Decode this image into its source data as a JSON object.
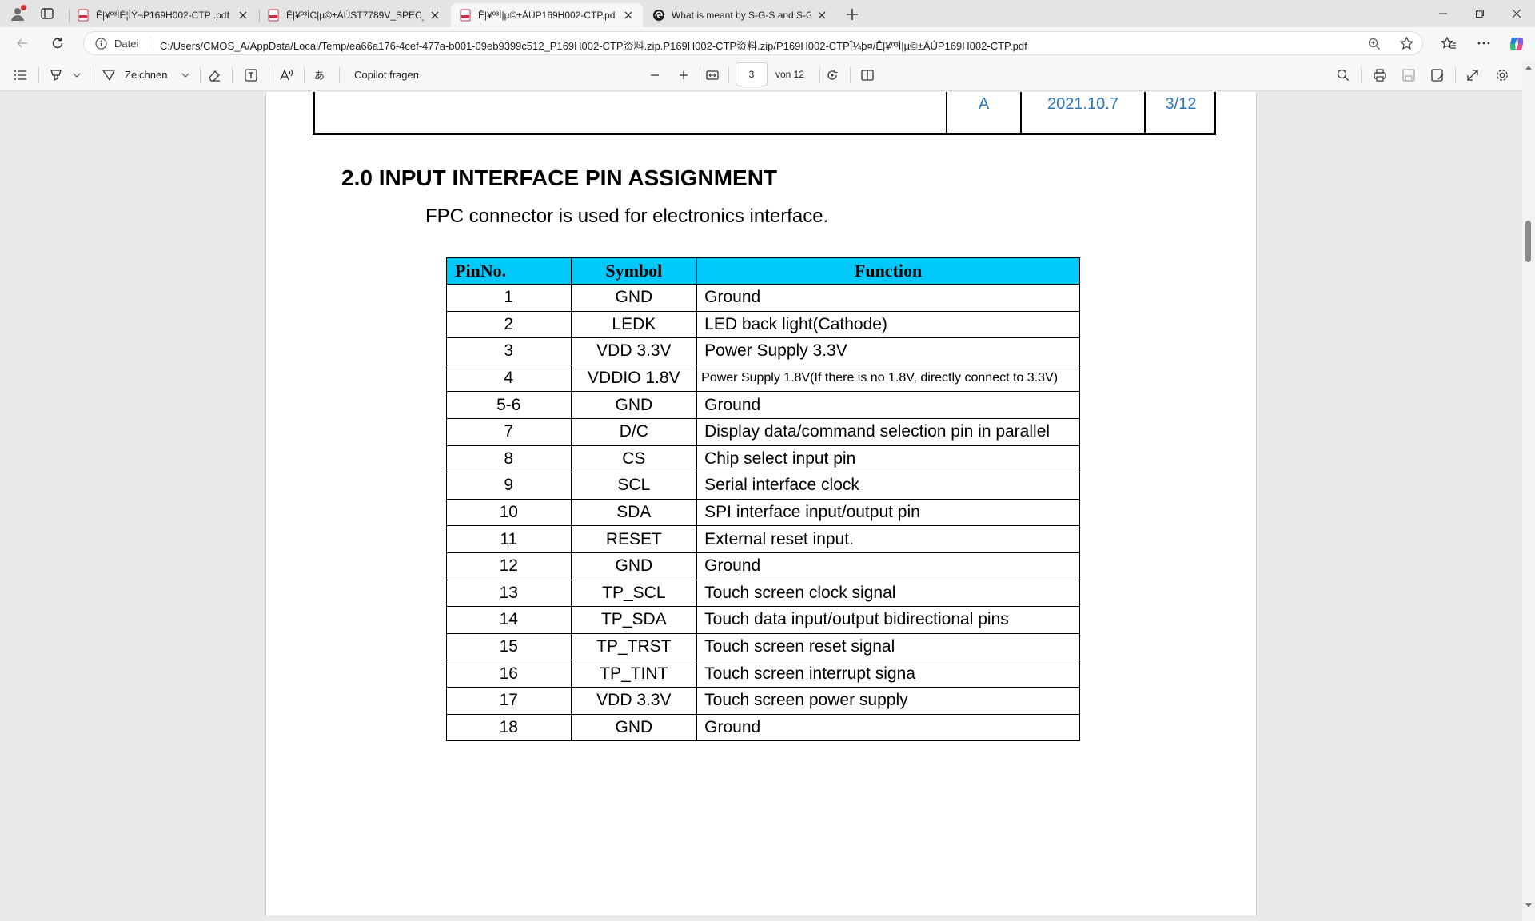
{
  "browser": {
    "tabs": [
      {
        "title": "Ê|¥º³ÌÈ¦ÌÝ¬P169H002-CTP .pdf",
        "active": false,
        "favicon": "pdf-icon"
      },
      {
        "title": "Ê|¥º³ÌC|µ©±ÁÚST7789V_SPEC_",
        "active": false,
        "favicon": "pdf-icon"
      },
      {
        "title": "Ê|¥º³Ì|µ©±ÁÚP169H002-CTP.pd",
        "active": true,
        "favicon": "pdf-icon"
      },
      {
        "title": "What is meant by S-G-S and S-G",
        "active": false,
        "favicon": "edge-icon"
      }
    ],
    "address": {
      "scheme_label": "Datei",
      "url": "C:/Users/CMOS_A/AppData/Local/Temp/ea66a176-4cef-477a-b001-09eb9399c512_P169H002-CTP资料.zip.P169H002-CTP资料.zip/P169H002-CTPÎ¼þ¤/Ê|¥º³Ì|µ©±ÁÚP169H002-CTP.pdf"
    }
  },
  "pdf_toolbar": {
    "draw_label": "Zeichnen",
    "copilot_label": "Copilot fragen",
    "page_number": "3",
    "page_total": "von 12"
  },
  "document": {
    "header_fragment": {
      "revision": "A",
      "date": "2021.10.7",
      "page": "3/12"
    },
    "heading": "2.0 INPUT INTERFACE PIN ASSIGNMENT",
    "intro": "FPC connector is used for electronics interface.",
    "table": {
      "columns": [
        "PinNo.",
        "Symbol",
        "Function"
      ],
      "rows": [
        {
          "pin": "1",
          "symbol": "GND",
          "function": "Ground"
        },
        {
          "pin": "2",
          "symbol": "LEDK",
          "function": "LED back light(Cathode)"
        },
        {
          "pin": "3",
          "symbol": "VDD 3.3V",
          "function": "Power Supply 3.3V"
        },
        {
          "pin": "4",
          "symbol": "VDDIO 1.8V",
          "function": "Power Supply 1.8V(If there is no 1.8V, directly connect to 3.3V)"
        },
        {
          "pin": "5-6",
          "symbol": "GND",
          "function": "Ground"
        },
        {
          "pin": "7",
          "symbol": "D/C",
          "function": "Display data/command selection pin in parallel"
        },
        {
          "pin": "8",
          "symbol": "CS",
          "function": "Chip select input pin"
        },
        {
          "pin": "9",
          "symbol": "SCL",
          "function": "Serial interface clock"
        },
        {
          "pin": "10",
          "symbol": "SDA",
          "function": "SPI interface input/output pin"
        },
        {
          "pin": "11",
          "symbol": "RESET",
          "function": "External reset input."
        },
        {
          "pin": "12",
          "symbol": "GND",
          "function": "Ground"
        },
        {
          "pin": "13",
          "symbol": "TP_SCL",
          "function": "Touch screen clock signal"
        },
        {
          "pin": "14",
          "symbol": "TP_SDA",
          "function": "Touch data input/output bidirectional pins"
        },
        {
          "pin": "15",
          "symbol": "TP_TRST",
          "function": "Touch screen reset signal"
        },
        {
          "pin": "16",
          "symbol": "TP_TINT",
          "function": "Touch screen interrupt signa"
        },
        {
          "pin": "17",
          "symbol": "VDD 3.3V",
          "function": "Touch screen power supply"
        },
        {
          "pin": "18",
          "symbol": "GND",
          "function": "Ground"
        }
      ]
    }
  },
  "colors": {
    "table_header_bg": "#00c8f8",
    "header_text": "#2e75b6"
  }
}
